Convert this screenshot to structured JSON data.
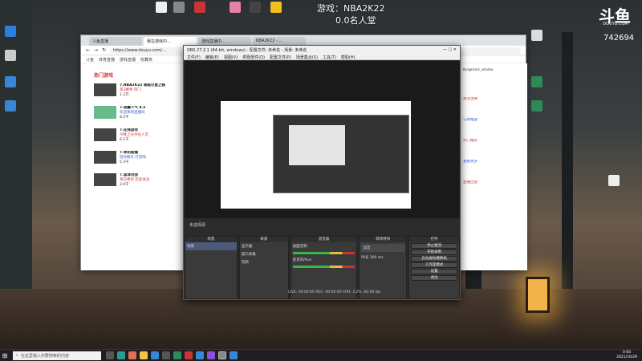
{
  "overlay": {
    "game_line": "游戏：NBA2K22",
    "rank_line": "0.0名人堂",
    "logo_text": "斗鱼",
    "logo_url": "DOUYU.COM",
    "room_id": "742694"
  },
  "browser": {
    "tabs": [
      "斗鱼直播",
      "我在游戏中...",
      "游戏直播中...",
      "NBA2K22 - ..."
    ],
    "address": "https://www.douyu.com/...",
    "bookmarks": [
      "斗鱼",
      "体育直播",
      "游戏直播",
      "收藏夹"
    ],
    "section_title": "热门游戏",
    "feed": [
      {
        "title": "7.NBA2K22 超级巨星之路",
        "line2": "第3赛季 热门",
        "line3": "1.2万"
      },
      {
        "title": "7.收藏人气 4.5",
        "line2": "欢迎来到直播间",
        "line3": "8.5千"
      },
      {
        "title": "7.在线游戏",
        "line2": "今晚上分冲名人堂",
        "line3": "6.1千"
      },
      {
        "title": "7.休闲直播",
        "line2": "陪你聊天 打游戏",
        "line3": "5.3千"
      },
      {
        "title": "7.篮球对战",
        "line2": "每日更新 欢迎关注",
        "line3": "3.9千"
      }
    ],
    "right_panel": {
      "user": "Kingrains_Studio",
      "lines": [
        "关注主播",
        "订阅推送",
        "热门推荐",
        "查看更多",
        "直播回放"
      ]
    }
  },
  "obs": {
    "title": "OBS 27.2.1 (64-bit, windows) - 配置文件: 未命名 - 场景: 未命名",
    "menu": [
      "文件(F)",
      "编辑(E)",
      "视图(V)",
      "停靠部件(D)",
      "配置文件(P)",
      "场景集合(S)",
      "工具(T)",
      "帮助(H)"
    ],
    "scene_label": "未选择源",
    "panels": {
      "scenes": "场景",
      "sources": "来源",
      "mixer": "混音器",
      "transitions": "转场特效",
      "controls": "控件"
    },
    "scene_items": [
      "场景"
    ],
    "source_items": [
      "显示器",
      "窗口采集",
      "音频"
    ],
    "mixer_items": [
      "桌面音频",
      "麦克风/Aux"
    ],
    "transition": {
      "name": "淡出",
      "duration_label": "时长",
      "duration": "300 ms"
    },
    "controls": [
      "停止推流",
      "开始录制",
      "启动虚拟摄像机",
      "工作室模式",
      "设置",
      "退出"
    ],
    "status": "LIVE: 00:00:00  REC: 00:00:00  CPU: 3.2%, 60.00 fps"
  },
  "taskbar": {
    "search_placeholder": "在这里输入你要搜索的内容",
    "time": "0:00",
    "date": "2021/10/29"
  },
  "colors": {
    "obs_bg": "#2b2b2b",
    "taskbar": "#1d1f22",
    "lantern": "#f2b34a"
  }
}
